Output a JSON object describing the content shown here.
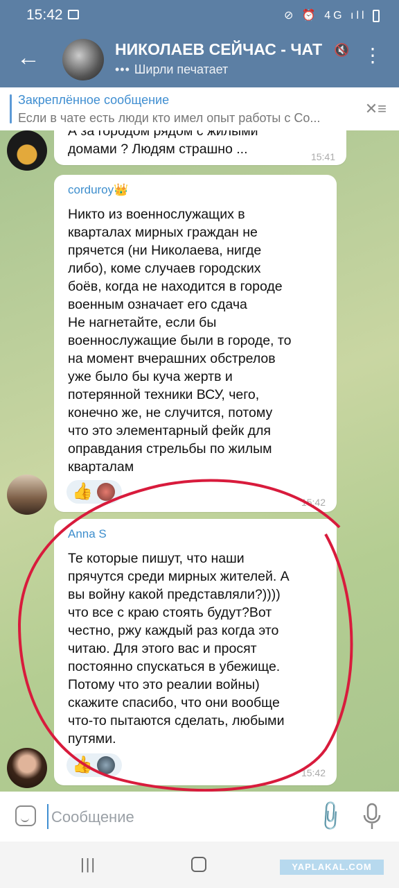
{
  "status_bar": {
    "time": "15:42",
    "right_icons": "⊘ ⏰ 4G ıll"
  },
  "header": {
    "title": "НИКОЛАЕВ СЕЙЧАС - ЧАТ",
    "subtitle": "Ширли печатает",
    "typing_dots": "•••"
  },
  "pinned": {
    "title": "Закреплённое сообщение",
    "text": "Если в чате есть люди кто имел опыт работы с Со..."
  },
  "messages": [
    {
      "author": "",
      "lines": [
        "А за городом рядом с жилыми",
        "домами ?  Людям страшно ..."
      ],
      "time": "15:41"
    },
    {
      "author": "corduroy👑",
      "lines": [
        "Никто из военнослужащих в",
        "кварталах мирных граждан не",
        "прячется (ни Николаева, нигде",
        "либо), коме случаев городских",
        "боёв, когда не находится в городе",
        "военным означает его сдача",
        "Не нагнетайте, если бы",
        "военнослужащие были в городе, то",
        "на момент вчерашних обстрелов",
        "уже было бы куча жертв и",
        "потерянной техники ВСУ, чего,",
        "конечно же, не случится, потому",
        "что это элементарный фейк для",
        "оправдания стрельбы по жилым",
        "кварталам"
      ],
      "reaction": "👍",
      "time": "15:42"
    },
    {
      "author": "Anna S",
      "lines": [
        "Те которые пишут, что наши",
        "прячутся среди мирных жителей. А",
        "вы войну какой представляли?))))",
        "что все с краю стоять будут?Вот",
        "честно, ржу каждый раз когда это",
        "читаю. Для этого вас и просят",
        "постоянно спускаться в убежище.",
        "Потому что это реалии войны)",
        "скажите спасибо, что они вообще",
        "что-то пытаются сделать, любыми",
        "путями."
      ],
      "reaction": "👍",
      "time": "15:42"
    }
  ],
  "composer": {
    "placeholder": "Сообщение"
  },
  "watermark": "YAPLAKAL.COM",
  "colors": {
    "header": "#5c7fa4",
    "accent": "#3f8ed1",
    "annotation": "#d81b3c"
  }
}
